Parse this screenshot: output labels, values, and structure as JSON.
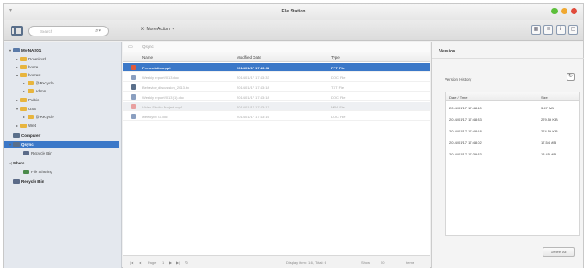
{
  "window": {
    "title": "File Station"
  },
  "toolbar": {
    "search_placeholder": "Search",
    "more_action_label": "More Action"
  },
  "sidebar": {
    "items": [
      {
        "label": "My-NAS01",
        "icon": "nas-icon",
        "bold": true
      },
      {
        "label": "Download",
        "icon": "folder-icon"
      },
      {
        "label": "home",
        "icon": "folder-icon"
      },
      {
        "label": "homes",
        "icon": "folder-icon"
      },
      {
        "label": "@Recycle",
        "icon": "folder-icon"
      },
      {
        "label": "admin",
        "icon": "folder-icon"
      },
      {
        "label": "Public",
        "icon": "folder-icon"
      },
      {
        "label": "USB",
        "icon": "folder-icon"
      },
      {
        "label": "@Recycle",
        "icon": "folder-icon"
      },
      {
        "label": "Web",
        "icon": "folder-icon"
      },
      {
        "label": "Computer",
        "icon": "computer-icon",
        "bold": true
      },
      {
        "label": "Qsync",
        "icon": "qsync-icon",
        "bold": true,
        "selected": true
      },
      {
        "label": "Recycle Bin",
        "icon": "recycle-icon"
      },
      {
        "label": "Share",
        "icon": "share-icon",
        "bold": true
      },
      {
        "label": "File Sharing",
        "icon": "share-icon"
      },
      {
        "label": "Recycle Bin",
        "icon": "recycle-bin-icon",
        "bold": true
      }
    ]
  },
  "main": {
    "path": "Qsync",
    "columns": [
      "Name",
      "Modified Date",
      "Type"
    ],
    "rows": [
      {
        "name": "Presentation.ppt",
        "date": "2014/01/17 17:43:32",
        "type": "PPT File",
        "selected": true,
        "icon_color": "#e05a3a"
      },
      {
        "name": "Weekly report2013.doc",
        "date": "2014/01/17 17:43:33",
        "type": "DOC File",
        "icon_color": "#8a9fc0"
      },
      {
        "name": "Behavior_discussion_2013.txt",
        "date": "2014/01/17 17:43:18",
        "type": "TXT File",
        "icon_color": "#5a6f8a"
      },
      {
        "name": "Weekly report2013 (1).doc",
        "date": "2014/01/17 17:43:18",
        "type": "DOC File",
        "icon_color": "#8a9fc0"
      },
      {
        "name": "Video Studio Project.mp4",
        "date": "2014/01/17 17:43:17",
        "type": "MP4 File",
        "icon_color": "#e8a0a0",
        "alt": true
      },
      {
        "name": "weeklyMTG.doc",
        "date": "2014/01/17 17:43:16",
        "type": "DOC File",
        "icon_color": "#8a9fc0"
      }
    ],
    "status": {
      "page_label": "Page",
      "page_value": "1",
      "display_info": "Display item: 1-6, Total: 6",
      "show_label": "Show",
      "show_value": "50",
      "items_label": "Items"
    }
  },
  "panel": {
    "title": "Version",
    "history_label": "Version History",
    "columns": [
      "Date / Time",
      "Size"
    ],
    "rows": [
      {
        "date": "2014/01/17 17:48:40",
        "size": "3.47 MB"
      },
      {
        "date": "2014/01/17 17:48:33",
        "size": "279.56 KB"
      },
      {
        "date": "2014/01/17 17:48:18",
        "size": "274.56 KB"
      },
      {
        "date": "2014/01/17 17:48:02",
        "size": "17.54 MB"
      },
      {
        "date": "2014/01/17 17:39:33",
        "size": "13.45 MB"
      }
    ],
    "delete_all_label": "Delete All"
  }
}
